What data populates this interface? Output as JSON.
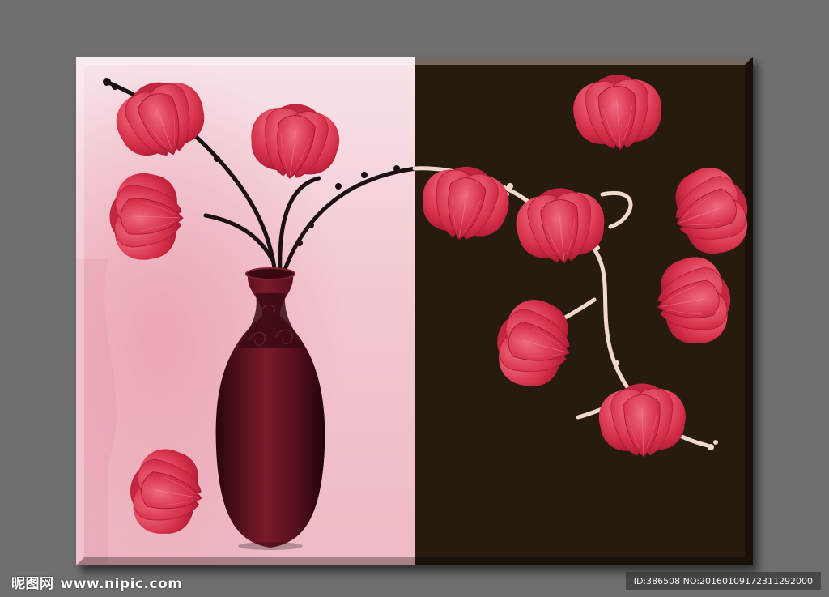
{
  "watermark": {
    "site_name": "昵图网",
    "site_url": "www.nipic.com",
    "image_info": "ID:386508 NO:20160109172311292000"
  },
  "colors": {
    "background": "#6f6f6f",
    "left_panel": "#f4d6dc",
    "right_panel": "#271a0e",
    "flower_red": "#d6304a",
    "vase": "#5c1420",
    "dark_branch": "#1c1012",
    "light_branch": "#f0d8cc"
  }
}
